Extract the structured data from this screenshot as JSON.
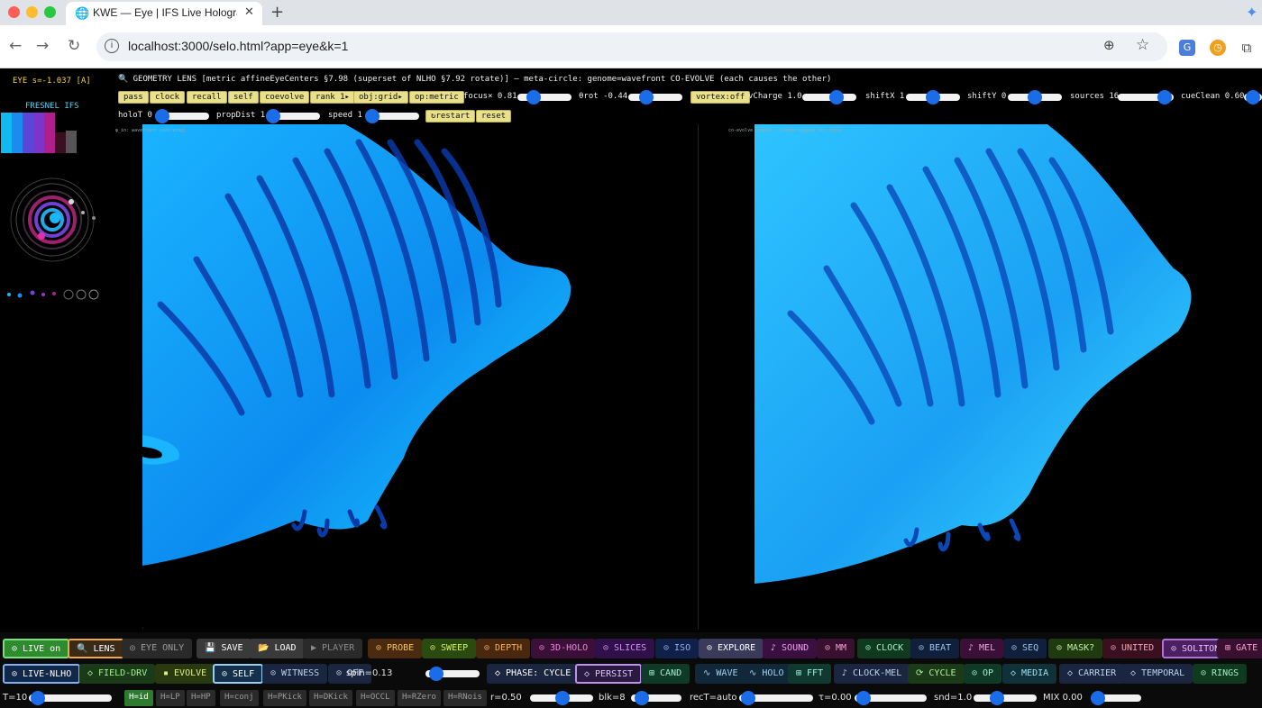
{
  "browser": {
    "tab_title": "KWE — Eye | IFS Live Hologra",
    "url": "localhost:3000/selo.html?app=eye&k=1",
    "colors": {
      "close": "#ff5f57",
      "minimize": "#febc2e",
      "maximize": "#28c840"
    }
  },
  "sidebar": {
    "eye_status": "EYE s=-1.037 [A]",
    "fresnel_label": "FRESNEL IFS",
    "swatch_colors": [
      "#12b8f0",
      "#1a8cf0",
      "#5a46d8",
      "#7b35c8",
      "#b01e8c",
      "#3a1020",
      "#555555"
    ]
  },
  "header": {
    "title": "🔍 GEOMETRY LENS [metric affineEyeCenters §7.98 (superset of NLHO §7.92 rotate)] — meta-circle: genome=wavefront CO-EVOLVE (each causes the other)",
    "buttons": [
      "pass",
      "clock",
      "recall",
      "self",
      "coevolve",
      "rank 1▸",
      "obj:grid▸",
      "op:metric"
    ],
    "focus_label": "focus× 0.81",
    "rot_label": "θrot -0.44",
    "vortex_button": "vortex:off",
    "vcharge_label": "vCharge 1.0",
    "shiftx_label": "shiftX 1",
    "shifty_label": "shiftY 0",
    "sources_label": "sources 16",
    "cueclean_label": "cueClean 0.60",
    "holot_label": "holoT 0",
    "propdist_label": "propDist 1",
    "speed_label": "speed 1",
    "restart_button": "↻restart",
    "reset_button": "reset"
  },
  "panels": {
    "left_label": "φ_in: wavefront (evolving)",
    "right_label": "co-evolve step64 — genome chases its focus"
  },
  "bottom_row1": [
    {
      "label": "⊙ LIVE on",
      "bg": "#2e8b2e",
      "fg": "#ffffff",
      "border": "#7be07b"
    },
    {
      "label": "🔍 LENS",
      "bg": "#3a2a18",
      "fg": "#ffffff",
      "border": "#f0a848"
    },
    {
      "label": "◎ EYE ONLY",
      "bg": "#2a2a2a",
      "fg": "#9a9a9a",
      "border": "#2a2a2a"
    },
    {
      "label": "💾 SAVE",
      "bg": "#3a3a3a",
      "fg": "#ffffff",
      "border": "#3a3a3a"
    },
    {
      "label": "📂 LOAD",
      "bg": "#3a3a3a",
      "fg": "#ffffff",
      "border": "#3a3a3a"
    },
    {
      "label": "▶ PLAYER",
      "bg": "#2a2a2a",
      "fg": "#8a8a8a",
      "border": "#2a2a2a"
    },
    {
      "label": "⊙ PROBE",
      "bg": "#4a2a10",
      "fg": "#f0c060",
      "border": "#4a2a10"
    },
    {
      "label": "⊙ SWEEP",
      "bg": "#2a4a10",
      "fg": "#d0f060",
      "border": "#2a4a10"
    },
    {
      "label": "⊙ DEPTH",
      "bg": "#4a2810",
      "fg": "#f0b060",
      "border": "#4a2810"
    },
    {
      "label": "⊙ 3D-HOLO",
      "bg": "#3a1038",
      "fg": "#f080e0",
      "border": "#3a1038"
    },
    {
      "label": "⊙ SLICES",
      "bg": "#301048",
      "fg": "#d090f0",
      "border": "#301048"
    },
    {
      "label": "⊙ ISO",
      "bg": "#102048",
      "fg": "#90b0f0",
      "border": "#102048"
    },
    {
      "label": "⊙ EXPLORE",
      "bg": "#3a3a5a",
      "fg": "#ffffff",
      "border": "#3a3a5a"
    },
    {
      "label": "♪ SOUND",
      "bg": "#3a1040",
      "fg": "#f0a0f0",
      "border": "#3a1040"
    },
    {
      "label": "⊙ MM",
      "bg": "#3a1030",
      "fg": "#f0a0d0",
      "border": "#3a1030"
    },
    {
      "label": "⊙ CLOCK",
      "bg": "#103a20",
      "fg": "#a0f0c0",
      "border": "#103a20"
    },
    {
      "label": "⊙ BEAT",
      "bg": "#10203a",
      "fg": "#a0c0f0",
      "border": "#10203a"
    },
    {
      "label": "♪ MEL",
      "bg": "#3a1038",
      "fg": "#f0a0e0",
      "border": "#3a1038"
    },
    {
      "label": "⊙ SEQ",
      "bg": "#10203a",
      "fg": "#a0c0f0",
      "border": "#10203a"
    },
    {
      "label": "⊙ MASK?",
      "bg": "#203a10",
      "fg": "#c0f0a0",
      "border": "#203a10"
    },
    {
      "label": "⊙ UNITED",
      "bg": "#3a1020",
      "fg": "#f0a0b0",
      "border": "#3a1020"
    },
    {
      "label": "⊙ SOLITON",
      "bg": "#4a2060",
      "fg": "#f0c0ff",
      "border": "#b070e0"
    },
    {
      "label": "⊞ GATE",
      "bg": "#3a1030",
      "fg": "#f0a0d0",
      "border": "#3a1030"
    }
  ],
  "bottom_row2": [
    {
      "label": "⊙ LIVE-NLHO",
      "bg": "#12284a",
      "fg": "#ffffff",
      "border": "#80b0f0"
    },
    {
      "label": "◇ FIELD-DRV",
      "bg": "#1a3a18",
      "fg": "#a0f090",
      "border": "#1a3a18"
    },
    {
      "label": "▪ EVOLVE",
      "bg": "#2a3a10",
      "fg": "#e0f080",
      "border": "#2a3a10"
    },
    {
      "label": "⊙ SELF",
      "bg": "#14304a",
      "fg": "#ffffff",
      "border": "#90d0f0"
    },
    {
      "label": "⊙ WITNESS",
      "bg": "#1a2640",
      "fg": "#c0d0f0",
      "border": "#1a2640"
    },
    {
      "label": "⊙ OFF",
      "bg": "#1a2640",
      "fg": "#c0d0f0",
      "border": "#1a2640"
    },
    {
      "label": "◇ PHASE: CYCLE",
      "bg": "#1a2640",
      "fg": "#ffffff",
      "border": "#1a2640"
    },
    {
      "label": "◇ PERSIST",
      "bg": "#2a1a40",
      "fg": "#e0c0ff",
      "border": "#c090f0"
    },
    {
      "label": "⊞ CAND",
      "bg": "#103a28",
      "fg": "#a0f0d0",
      "border": "#103a28"
    },
    {
      "label": "∿ WAVE",
      "bg": "#10283a",
      "fg": "#a0d0f0",
      "border": "#10283a"
    },
    {
      "label": "∿ HOLO",
      "bg": "#10283a",
      "fg": "#a0d0f0",
      "border": "#10283a"
    },
    {
      "label": "⊞ FFT",
      "bg": "#103a30",
      "fg": "#a0f0e0",
      "border": "#103a30"
    },
    {
      "label": "♪ CLOCK-MEL",
      "bg": "#1a2640",
      "fg": "#c0d0f0",
      "border": "#1a2640"
    },
    {
      "label": "⟳ CYCLE",
      "bg": "#1a3a18",
      "fg": "#b0f0a0",
      "border": "#1a3a18"
    },
    {
      "label": "⊙ OP",
      "bg": "#103a28",
      "fg": "#a0f0d0",
      "border": "#103a28"
    },
    {
      "label": "◇ MEDIA",
      "bg": "#10303a",
      "fg": "#a0e0f0",
      "border": "#10303a"
    },
    {
      "label": "◇ CARRIER",
      "bg": "#1a2640",
      "fg": "#c0d0f0",
      "border": "#1a2640"
    },
    {
      "label": "◇ TEMPORAL",
      "bg": "#1a2640",
      "fg": "#c0d0f0",
      "border": "#1a2640"
    },
    {
      "label": "⊙ RINGS",
      "bg": "#103a20",
      "fg": "#a0f0c0",
      "border": "#103a20"
    }
  ],
  "spin_label": "spin=0.13",
  "bottom_row3": {
    "t_label": "T=10",
    "h_buttons": [
      {
        "label": "H=id",
        "active": true
      },
      {
        "label": "H=LP",
        "active": false
      },
      {
        "label": "H=HP",
        "active": false
      },
      {
        "label": "H=conj",
        "active": false
      },
      {
        "label": "H=PKick",
        "active": false
      },
      {
        "label": "H=DKick",
        "active": false
      },
      {
        "label": "H=OCCL",
        "active": false
      },
      {
        "label": "H=RZero",
        "active": false
      },
      {
        "label": "H=RNois",
        "active": false
      }
    ],
    "r_label": "r=0.50",
    "blk_label": "blk=8",
    "rect_label": "recT=auto",
    "tau_label": "τ=0.00",
    "snd_label": "snd=1.0",
    "mix_label": "MIX 0.00"
  }
}
